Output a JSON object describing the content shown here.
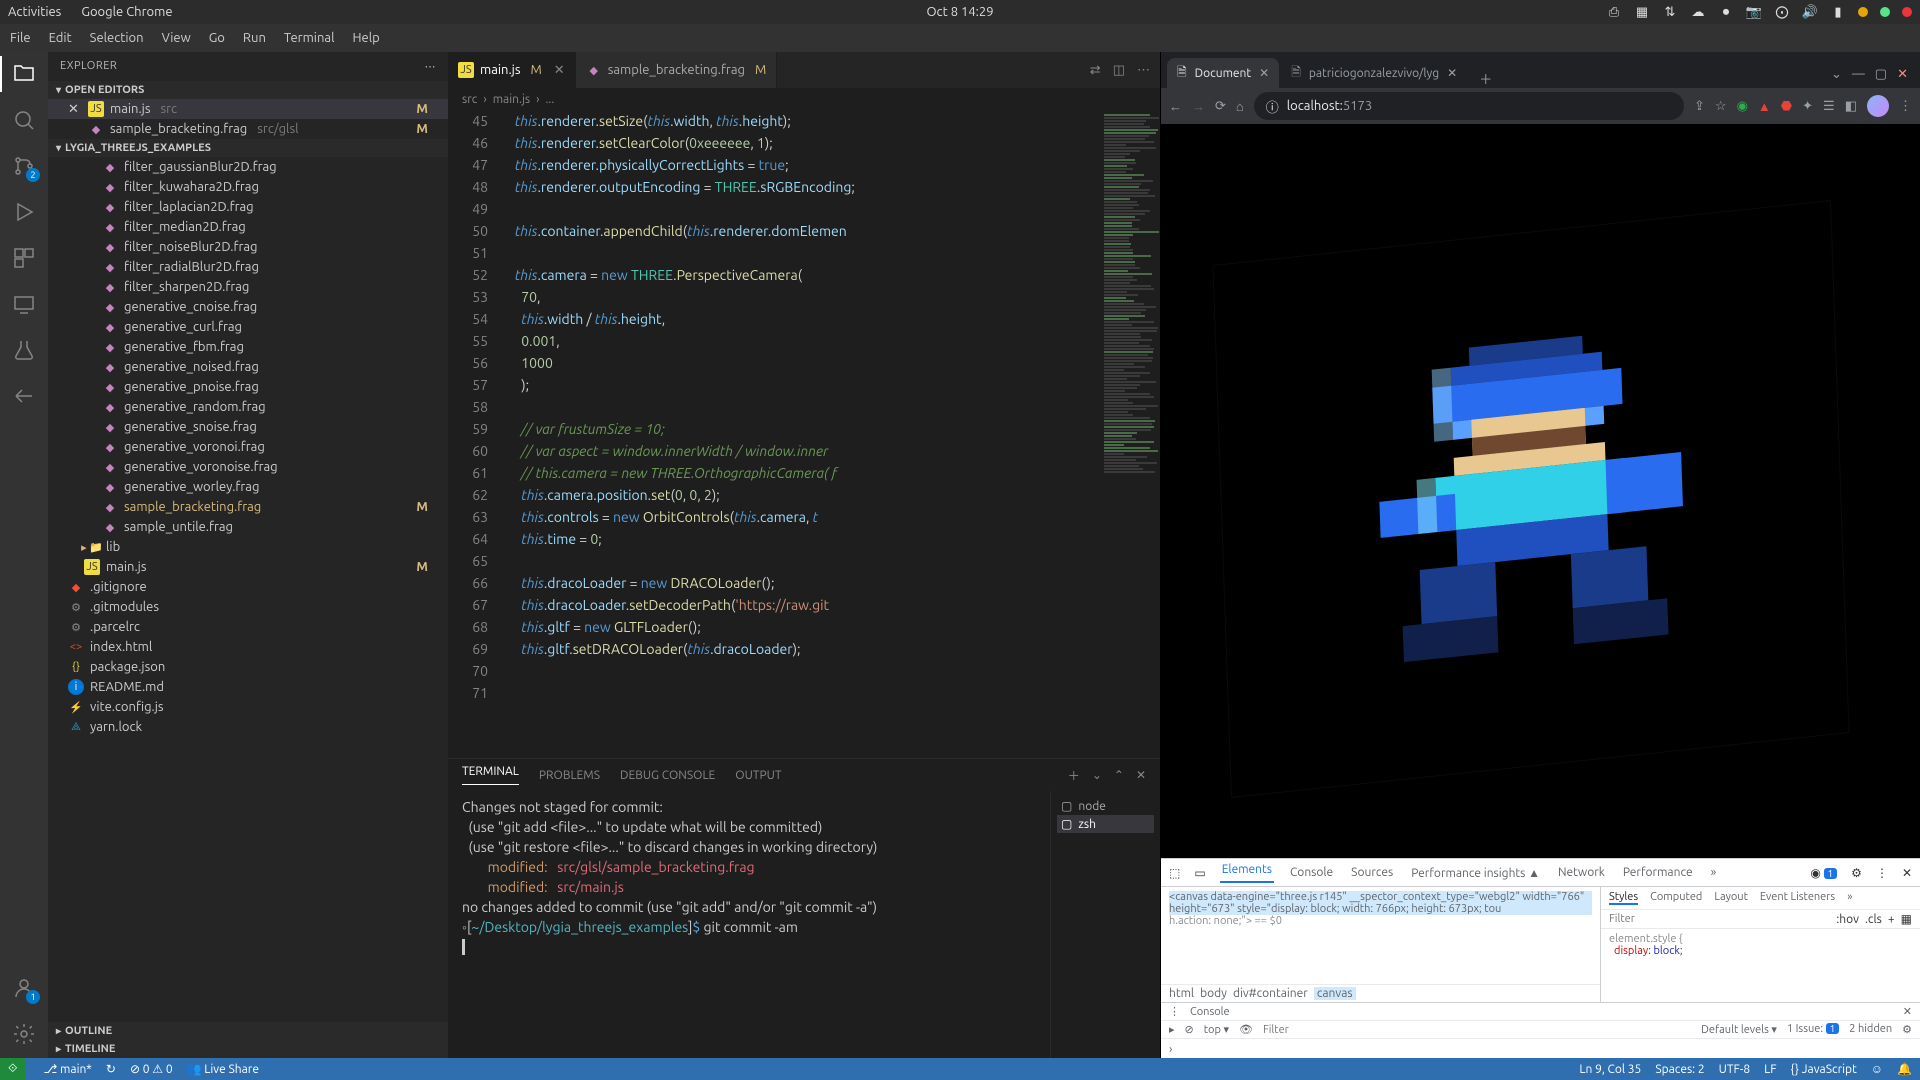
{
  "gnome": {
    "activities": "Activities",
    "app": "Google Chrome",
    "clock": "Oct 8  14:29"
  },
  "vscode_menu": [
    "File",
    "Edit",
    "Selection",
    "View",
    "Go",
    "Run",
    "Terminal",
    "Help"
  ],
  "explorer": {
    "title": "EXPLORER",
    "openEditorsTitle": "OPEN EDITORS",
    "openEditors": [
      {
        "icon": "js",
        "name": "main.js",
        "dir": "src",
        "m": true,
        "active": true
      },
      {
        "icon": "frag",
        "name": "sample_bracketing.frag",
        "dir": "src/glsl",
        "m": true
      }
    ],
    "projectTitle": "LYGIA_THREEJS_EXAMPLES",
    "files": [
      {
        "icon": "frag",
        "name": "filter_gaussianBlur2D.frag",
        "indent": 2
      },
      {
        "icon": "frag",
        "name": "filter_kuwahara2D.frag",
        "indent": 2
      },
      {
        "icon": "frag",
        "name": "filter_laplacian2D.frag",
        "indent": 2
      },
      {
        "icon": "frag",
        "name": "filter_median2D.frag",
        "indent": 2
      },
      {
        "icon": "frag",
        "name": "filter_noiseBlur2D.frag",
        "indent": 2
      },
      {
        "icon": "frag",
        "name": "filter_radialBlur2D.frag",
        "indent": 2
      },
      {
        "icon": "frag",
        "name": "filter_sharpen2D.frag",
        "indent": 2
      },
      {
        "icon": "frag",
        "name": "generative_cnoise.frag",
        "indent": 2
      },
      {
        "icon": "frag",
        "name": "generative_curl.frag",
        "indent": 2
      },
      {
        "icon": "frag",
        "name": "generative_fbm.frag",
        "indent": 2
      },
      {
        "icon": "frag",
        "name": "generative_noised.frag",
        "indent": 2
      },
      {
        "icon": "frag",
        "name": "generative_pnoise.frag",
        "indent": 2
      },
      {
        "icon": "frag",
        "name": "generative_random.frag",
        "indent": 2
      },
      {
        "icon": "frag",
        "name": "generative_snoise.frag",
        "indent": 2
      },
      {
        "icon": "frag",
        "name": "generative_voronoi.frag",
        "indent": 2
      },
      {
        "icon": "frag",
        "name": "generative_voronoise.frag",
        "indent": 2
      },
      {
        "icon": "frag",
        "name": "generative_worley.frag",
        "indent": 2
      },
      {
        "icon": "frag",
        "name": "sample_bracketing.frag",
        "indent": 2,
        "m": true,
        "hl": true
      },
      {
        "icon": "frag",
        "name": "sample_untile.frag",
        "indent": 2
      },
      {
        "icon": "folder",
        "name": "lib",
        "indent": 1,
        "chev": true
      },
      {
        "icon": "js",
        "name": "main.js",
        "indent": 1,
        "m": true
      },
      {
        "icon": "git",
        "name": ".gitignore",
        "indent": 0
      },
      {
        "icon": "dot",
        "name": ".gitmodules",
        "indent": 0
      },
      {
        "icon": "dot",
        "name": ".parcelrc",
        "indent": 0
      },
      {
        "icon": "html",
        "name": "index.html",
        "indent": 0
      },
      {
        "icon": "json",
        "name": "package.json",
        "indent": 0
      },
      {
        "icon": "info",
        "name": "README.md",
        "indent": 0
      },
      {
        "icon": "vite",
        "name": "vite.config.js",
        "indent": 0
      },
      {
        "icon": "yarn",
        "name": "yarn.lock",
        "indent": 0
      }
    ],
    "outline": "OUTLINE",
    "timeline": "TIMELINE"
  },
  "tabs": [
    {
      "icon": "js",
      "name": "main.js",
      "m": true,
      "active": true,
      "close": true
    },
    {
      "icon": "frag",
      "name": "sample_bracketing.frag",
      "m": true
    }
  ],
  "breadcrumb": [
    "src",
    "main.js",
    "..."
  ],
  "code": {
    "startLine": 45,
    "lines": [
      "<span class='tok-this'>this</span>.<span class='tok-prop'>renderer</span>.<span class='tok-fn'>setSize</span>(<span class='tok-this'>this</span>.<span class='tok-prop'>width</span>, <span class='tok-this'>this</span>.<span class='tok-prop'>height</span>);",
      "<span class='tok-this'>this</span>.<span class='tok-prop'>renderer</span>.<span class='tok-fn'>setClearColor</span>(<span class='tok-num'>0xeeeeee</span>, <span class='tok-num'>1</span>);",
      "<span class='tok-this'>this</span>.<span class='tok-prop'>renderer</span>.<span class='tok-prop'>physicallyCorrectLights</span> = <span class='tok-bool'>true</span>;",
      "<span class='tok-this'>this</span>.<span class='tok-prop'>renderer</span>.<span class='tok-prop'>outputEncoding</span> = <span class='tok-type'>THREE</span>.<span class='tok-prop'>sRGBEncoding</span>;",
      "",
      "<span class='tok-this'>this</span>.<span class='tok-prop'>container</span>.<span class='tok-fn'>appendChild</span>(<span class='tok-this'>this</span>.<span class='tok-prop'>renderer</span>.<span class='tok-prop'>domElemen</span>",
      "",
      "<span class='tok-this'>this</span>.<span class='tok-prop'>camera</span> = <span class='tok-kw'>new</span> <span class='tok-type'>THREE</span>.<span class='tok-fn'>PerspectiveCamera</span>(",
      "  <span class='tok-num'>70</span>,",
      "  <span class='tok-this'>this</span>.<span class='tok-prop'>width</span> / <span class='tok-this'>this</span>.<span class='tok-prop'>height</span>,",
      "  <span class='tok-num'>0.001</span>,",
      "  <span class='tok-num'>1000</span>",
      "  );",
      "",
      "  <span class='tok-comment'>// var frustumSize = 10;</span>",
      "  <span class='tok-comment'>// var aspect = window.innerWidth / window.inner</span>",
      "  <span class='tok-comment'>// this.camera = new THREE.OrthographicCamera( f</span>",
      "  <span class='tok-this'>this</span>.<span class='tok-prop'>camera</span>.<span class='tok-prop'>position</span>.<span class='tok-fn'>set</span>(<span class='tok-num'>0</span>, <span class='tok-num'>0</span>, <span class='tok-num'>2</span>);",
      "  <span class='tok-this'>this</span>.<span class='tok-prop'>controls</span> = <span class='tok-kw'>new</span> <span class='tok-fn'>OrbitControls</span>(<span class='tok-this'>this</span>.<span class='tok-prop'>camera</span>, <span class='tok-this'>t</span>",
      "  <span class='tok-this'>this</span>.<span class='tok-prop'>time</span> = <span class='tok-num'>0</span>;",
      "",
      "  <span class='tok-this'>this</span>.<span class='tok-prop'>dracoLoader</span> = <span class='tok-kw'>new</span> <span class='tok-fn'>DRACOLoader</span>();",
      "  <span class='tok-this'>this</span>.<span class='tok-prop'>dracoLoader</span>.<span class='tok-fn'>setDecoderPath</span>(<span class='tok-str'>'https://raw.git</span>",
      "  <span class='tok-this'>this</span>.<span class='tok-prop'>gltf</span> = <span class='tok-kw'>new</span> <span class='tok-fn'>GLTFLoader</span>();",
      "  <span class='tok-this'>this</span>.<span class='tok-prop'>gltf</span>.<span class='tok-fn'>setDRACOLoader</span>(<span class='tok-this'>this</span>.<span class='tok-prop'>dracoLoader</span>);",
      "",
      ""
    ]
  },
  "panel": {
    "tabs": [
      "TERMINAL",
      "PROBLEMS",
      "DEBUG CONSOLE",
      "OUTPUT"
    ],
    "terminals": [
      "node",
      "zsh"
    ],
    "output_lines": [
      {
        "t": "Changes not staged for commit:"
      },
      {
        "t": "  (use \"git add <file>...\" to update what will be committed)"
      },
      {
        "t": "  (use \"git restore <file>...\" to discard changes in working directory)"
      },
      {
        "t": "        modified:   src/glsl/sample_bracketing.frag",
        "cls": "mod"
      },
      {
        "t": "        modified:   src/main.js",
        "cls": "mod"
      },
      {
        "t": ""
      },
      {
        "t": "no changes added to commit (use \"git add\" and/or \"git commit -a\")"
      }
    ],
    "prompt_cwd": "~/Desktop/lygia_threejs_examples",
    "prompt_cmd": "git commit -am"
  },
  "status": {
    "branch": "main*",
    "sync": "↻",
    "errors": "0",
    "warnings": "0",
    "live": "Live Share",
    "ln": "Ln 9, Col 35",
    "spaces": "Spaces: 2",
    "enc": "UTF-8",
    "eol": "LF",
    "lang": "JavaScript"
  },
  "chrome": {
    "tabs": [
      {
        "title": "Document",
        "active": true
      },
      {
        "title": "patriciogonzalezvivo/lyg",
        "active": false
      }
    ],
    "url_host": "localhost:",
    "url_port": "5173",
    "url_prefix": "ⓘ  "
  },
  "devtools": {
    "tabs": [
      "Elements",
      "Console",
      "Sources",
      "Performance insights ▲",
      "Network",
      "Performance"
    ],
    "badge": "1",
    "canvas_line": "<canvas data-engine=\"three.js r145\" __spector_context_type=\"webgl2\" width=\"766\" height=\"673\" style=\"display: block; width: 766px; height: 673px; tou",
    "crumbs": [
      "html",
      "body",
      "div#container",
      "canvas"
    ],
    "styles_tabs": [
      "Styles",
      "Computed",
      "Layout",
      "Event Listeners"
    ],
    "filter_ph": "Filter",
    "hov": ":hov",
    "cls": ".cls",
    "rule_selector": "element.style {",
    "rule_prop": "display",
    "rule_val": "block",
    "console_tabs": "Console",
    "levels": "Default levels ▾",
    "issue": "1 Issue:",
    "issue_badge": "1",
    "hidden": "2 hidden",
    "top": "top ▾"
  }
}
